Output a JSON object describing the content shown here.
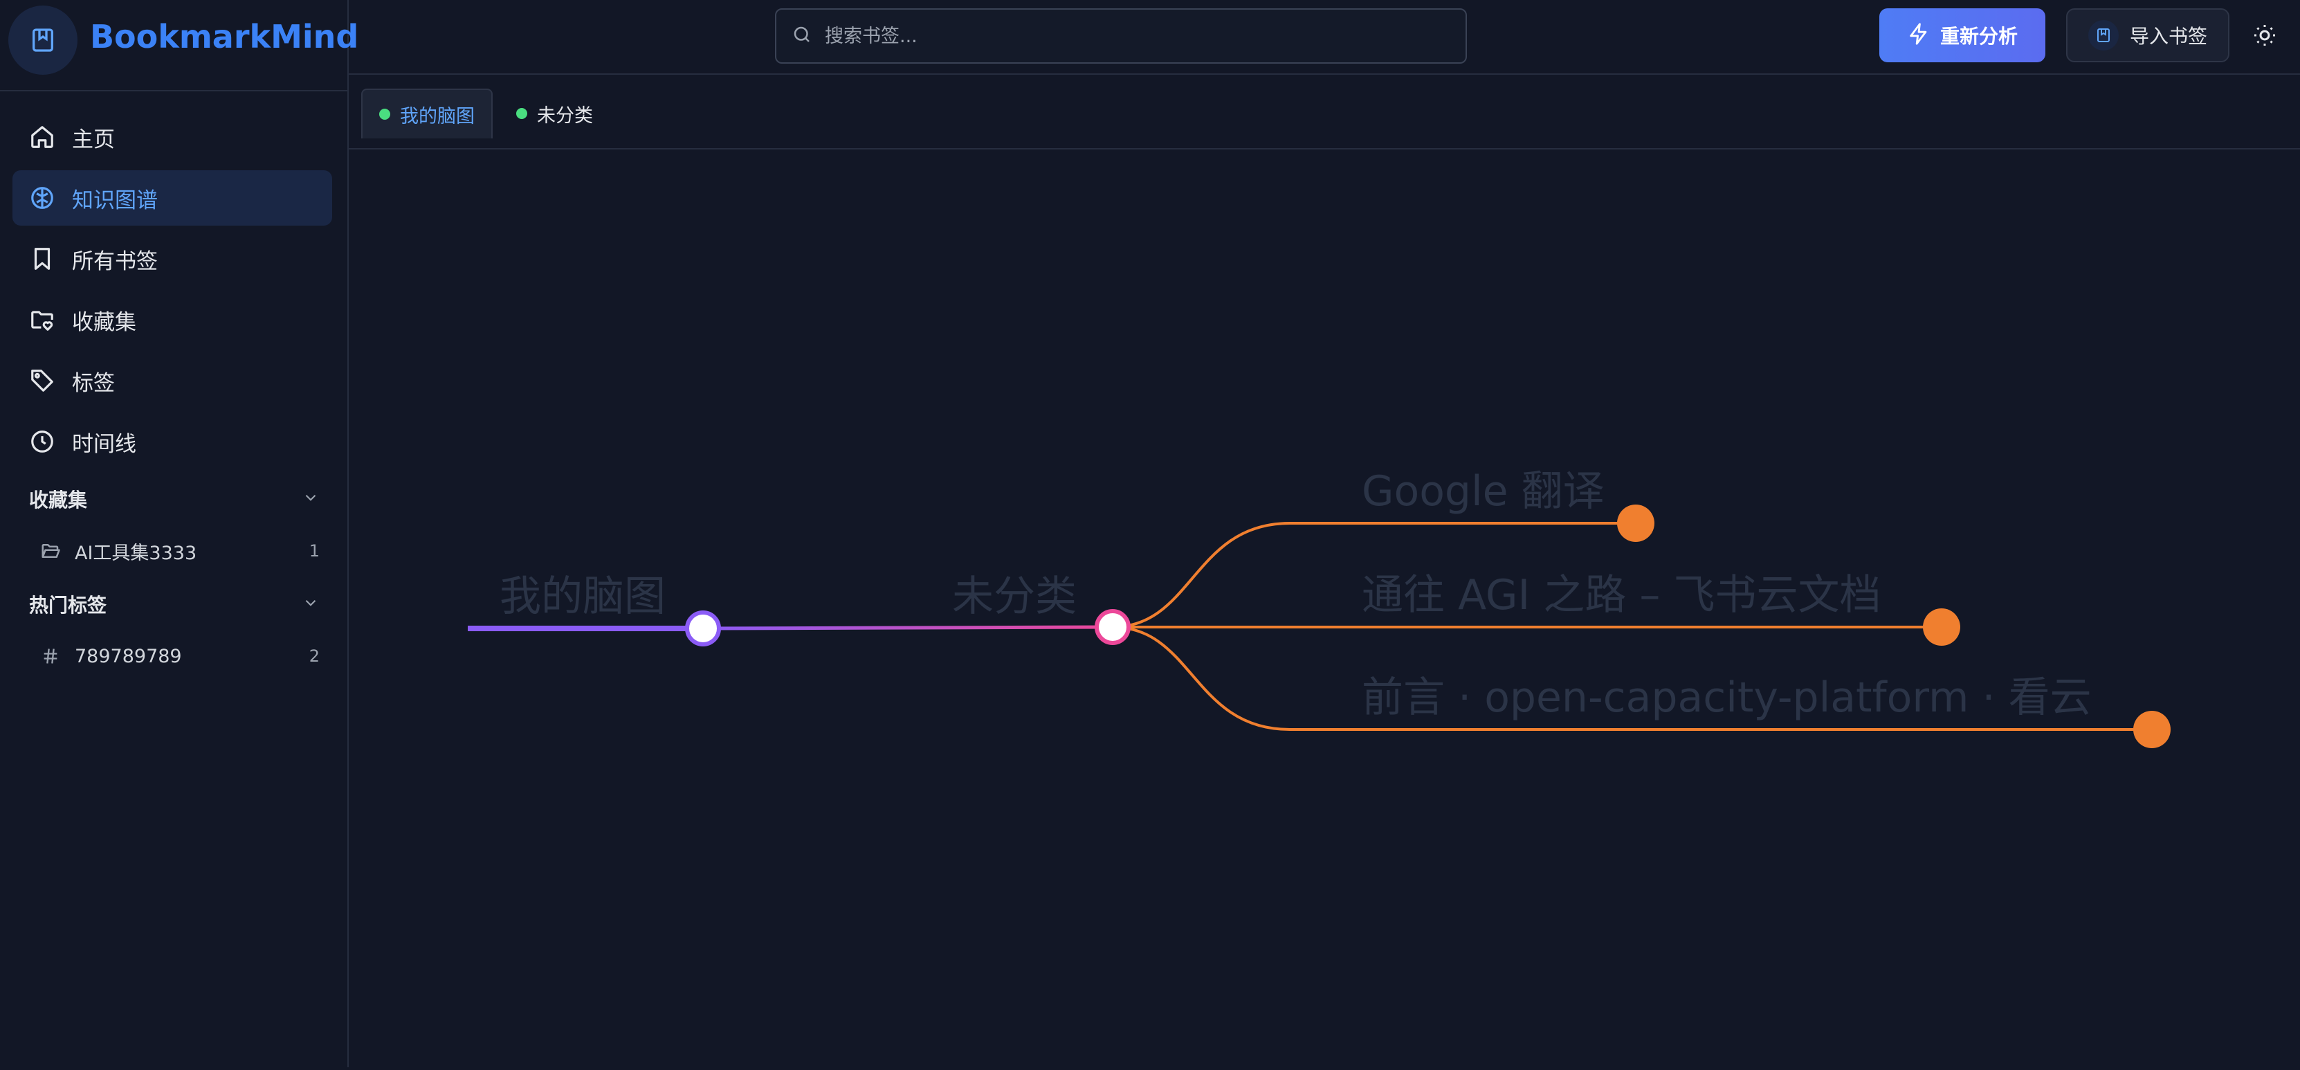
{
  "brand": {
    "name": "BookmarkMind",
    "logo_icon": "bookmark-book-icon"
  },
  "sidebar": {
    "nav": [
      {
        "label": "主页",
        "icon": "home-icon",
        "active": false
      },
      {
        "label": "知识图谱",
        "icon": "brain-icon",
        "active": true
      },
      {
        "label": "所有书签",
        "icon": "bookmark-icon",
        "active": false
      },
      {
        "label": "收藏集",
        "icon": "folder-heart-icon",
        "active": false
      },
      {
        "label": "标签",
        "icon": "tag-icon",
        "active": false
      },
      {
        "label": "时间线",
        "icon": "clock-icon",
        "active": false
      }
    ],
    "collections_header": "收藏集",
    "collections": [
      {
        "label": "AI工具集3333",
        "count": "1",
        "icon": "folder-open-icon"
      }
    ],
    "tags_header": "热门标签",
    "tags": [
      {
        "label": "789789789",
        "count": "2",
        "icon": "hash-icon"
      }
    ]
  },
  "topbar": {
    "search_placeholder": "搜索书签...",
    "reanalyze_label": "重新分析",
    "import_label": "导入书签"
  },
  "tabs": [
    {
      "label": "我的脑图",
      "active": true
    },
    {
      "label": "未分类",
      "active": false
    }
  ],
  "mindmap": {
    "root": "我的脑图",
    "child": "未分类",
    "leaves": [
      "Google 翻译",
      "通往 AGI 之路 – 飞书云文档",
      "前言 · open-capacity-platform · 看云"
    ],
    "colors": {
      "root": "#8b5cf6",
      "child": "#ec4899",
      "leaf": "#f07f2f"
    }
  }
}
